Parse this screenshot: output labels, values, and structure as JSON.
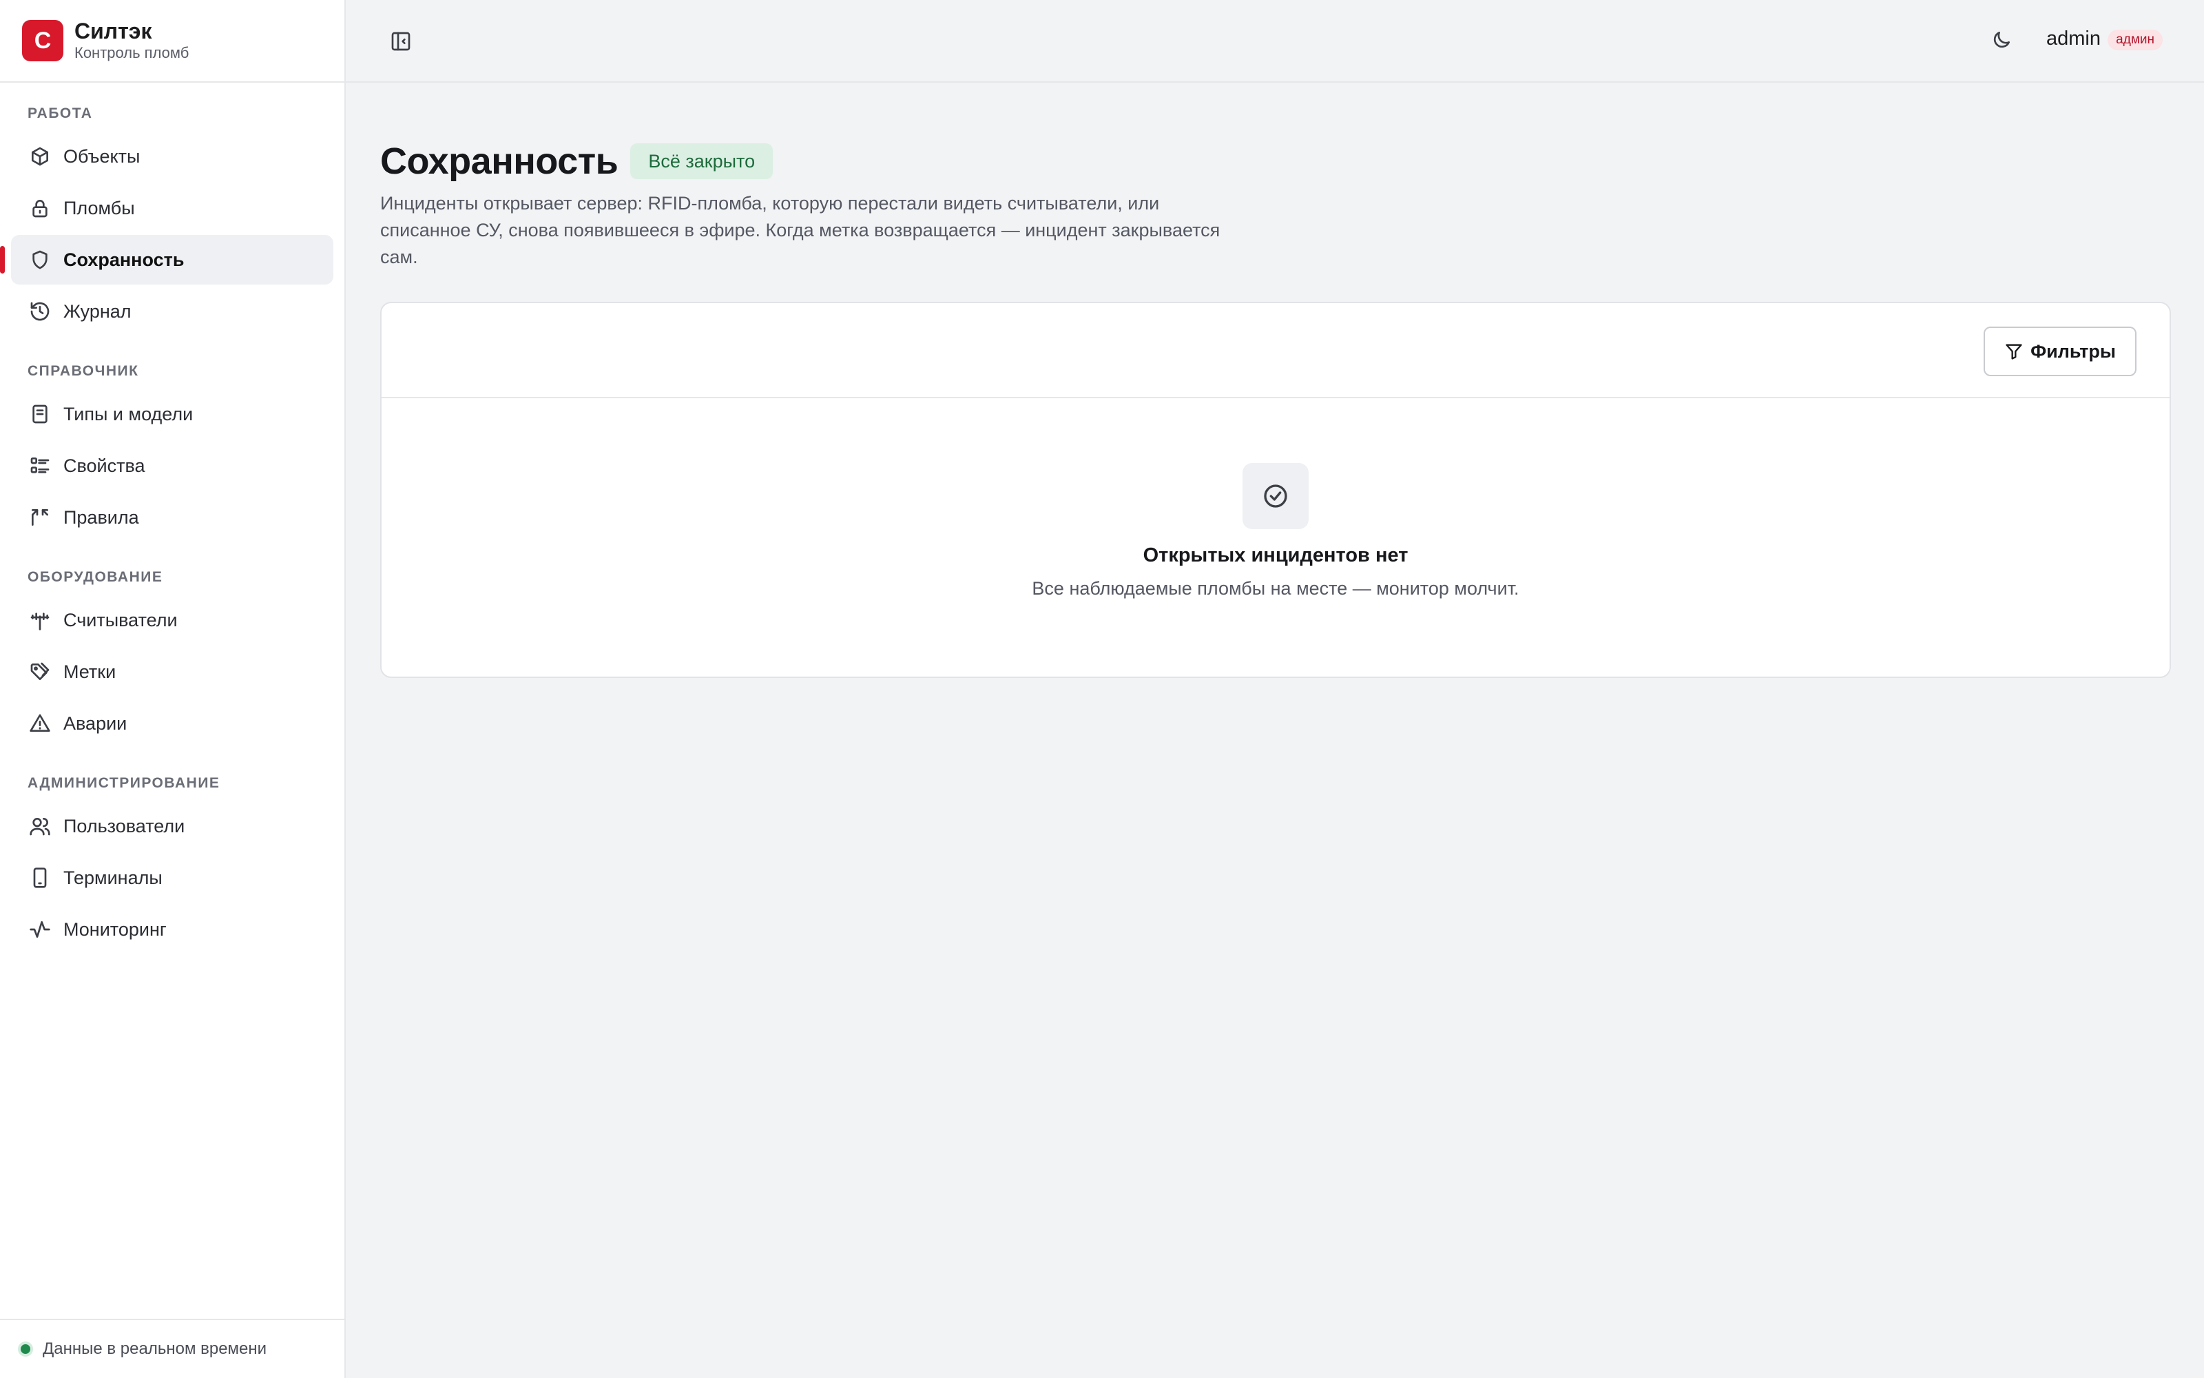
{
  "brand": {
    "logo_letter": "С",
    "title": "Силтэк",
    "subtitle": "Контроль пломб",
    "accent": "#d7192b"
  },
  "sidebar": {
    "sections": [
      {
        "label": "РАБОТА",
        "items": [
          {
            "label": "Объекты",
            "icon": "cube-icon"
          },
          {
            "label": "Пломбы",
            "icon": "lock-icon"
          },
          {
            "label": "Сохранность",
            "icon": "shield-icon",
            "active": true
          },
          {
            "label": "Журнал",
            "icon": "history-icon"
          }
        ]
      },
      {
        "label": "СПРАВОЧНИК",
        "items": [
          {
            "label": "Типы и модели",
            "icon": "book-icon"
          },
          {
            "label": "Свойства",
            "icon": "list-icon"
          },
          {
            "label": "Правила",
            "icon": "split-icon"
          }
        ]
      },
      {
        "label": "ОБОРУДОВАНИЕ",
        "items": [
          {
            "label": "Считыватели",
            "icon": "antenna-icon"
          },
          {
            "label": "Метки",
            "icon": "tags-icon"
          },
          {
            "label": "Аварии",
            "icon": "warning-icon"
          }
        ]
      },
      {
        "label": "АДМИНИСТРИРОВАНИЕ",
        "items": [
          {
            "label": "Пользователи",
            "icon": "users-icon"
          },
          {
            "label": "Терминалы",
            "icon": "phone-icon"
          },
          {
            "label": "Мониторинг",
            "icon": "activity-icon"
          }
        ]
      }
    ],
    "footer": {
      "status": "Данные в реальном времени",
      "status_color": "#1f8a4c"
    }
  },
  "topbar": {
    "user_name": "admin",
    "user_role": "админ"
  },
  "main": {
    "title": "Сохранность",
    "badge": "Всё закрыто",
    "description": "Инциденты открывает сервер: RFID-пломба, которую перестали видеть считыватели, или списанное СУ, снова появившееся в эфире. Когда метка возвращается — инцидент закрывается сам.",
    "filters_label": "Фильтры",
    "empty_title": "Открытых инцидентов нет",
    "empty_subtitle": "Все наблюдаемые пломбы на месте — монитор молчит."
  }
}
